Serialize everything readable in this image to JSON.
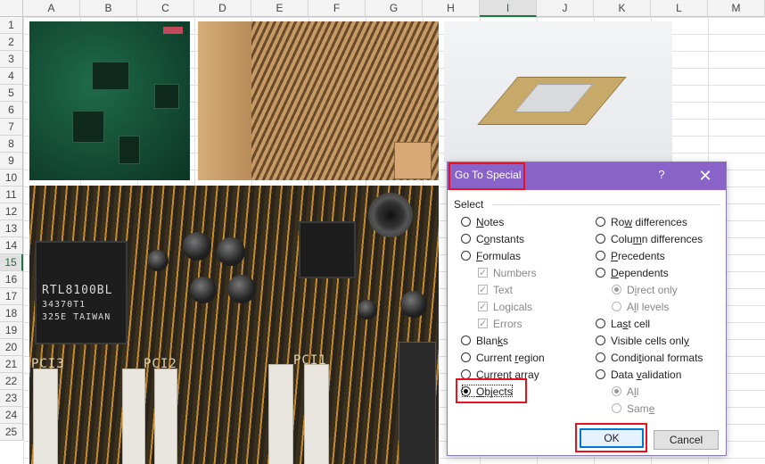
{
  "sheet": {
    "columns": [
      "A",
      "B",
      "C",
      "D",
      "E",
      "F",
      "G",
      "H",
      "I",
      "J",
      "K",
      "L",
      "M"
    ],
    "selected_column": "I",
    "rows": [
      "1",
      "2",
      "3",
      "4",
      "5",
      "6",
      "7",
      "8",
      "9",
      "10",
      "11",
      "12",
      "13",
      "14",
      "15",
      "16",
      "17",
      "18",
      "19",
      "20",
      "21",
      "22",
      "23",
      "24",
      "25"
    ],
    "selected_row": "15"
  },
  "pictures": {
    "motherboard_chip_main": "RTL8100BL",
    "motherboard_chip_line2": "34370T1",
    "motherboard_chip_line3": "325E TAIWAN",
    "motherboard_label_pci": "PCI3",
    "motherboard_label_pci2": "PCI2",
    "motherboard_label_pci1": "PCI1"
  },
  "dialog": {
    "title": "Go To Special",
    "help": "?",
    "close": "✕",
    "section_label": "Select",
    "left_options": {
      "notes": {
        "pre": "",
        "key": "N",
        "post": "otes"
      },
      "constants": {
        "pre": "C",
        "key": "o",
        "post": "nstants"
      },
      "formulas": {
        "pre": "",
        "key": "F",
        "post": "ormulas"
      },
      "blanks": {
        "pre": "Blan",
        "key": "k",
        "post": "s"
      },
      "current_region": {
        "pre": "Current ",
        "key": "r",
        "post": "egion"
      },
      "current_array": {
        "pre": "Current ",
        "key": "a",
        "post": "rray"
      },
      "objects": {
        "pre": "",
        "key": "O",
        "post": "bjects"
      }
    },
    "formula_checks": [
      "Numbers",
      "Text",
      "Logicals",
      "Errors"
    ],
    "right_options": {
      "row_differences": {
        "pre": "Ro",
        "key": "w",
        "post": " differences"
      },
      "column_differences": {
        "pre": "Colu",
        "key": "m",
        "post": "n differences"
      },
      "precedents": {
        "pre": "",
        "key": "P",
        "post": "recedents"
      },
      "dependents": {
        "pre": "",
        "key": "D",
        "post": "ependents"
      },
      "direct_only": {
        "pre": "D",
        "key": "i",
        "post": "rect only"
      },
      "all_levels": {
        "pre": "A",
        "key": "l",
        "post": "l levels"
      },
      "last_cell": {
        "pre": "La",
        "key": "s",
        "post": "t cell"
      },
      "visible_cells_only": {
        "pre": "Visible cells onl",
        "key": "y",
        "post": ""
      },
      "conditional_formats": {
        "pre": "Condi",
        "key": "t",
        "post": "ional formats"
      },
      "data_validation": {
        "pre": "Data ",
        "key": "v",
        "post": "alidation"
      },
      "all": {
        "pre": "A",
        "key": "l",
        "post": "l"
      },
      "same": {
        "pre": "Sam",
        "key": "e",
        "post": ""
      }
    },
    "selected_option": "Objects",
    "ok_label": "OK",
    "cancel_label": "Cancel"
  },
  "colors": {
    "title_bar": "#8a63c9",
    "highlight_box": "#e8111d",
    "excel_green": "#217346",
    "ok_focus": "#0078d7"
  }
}
